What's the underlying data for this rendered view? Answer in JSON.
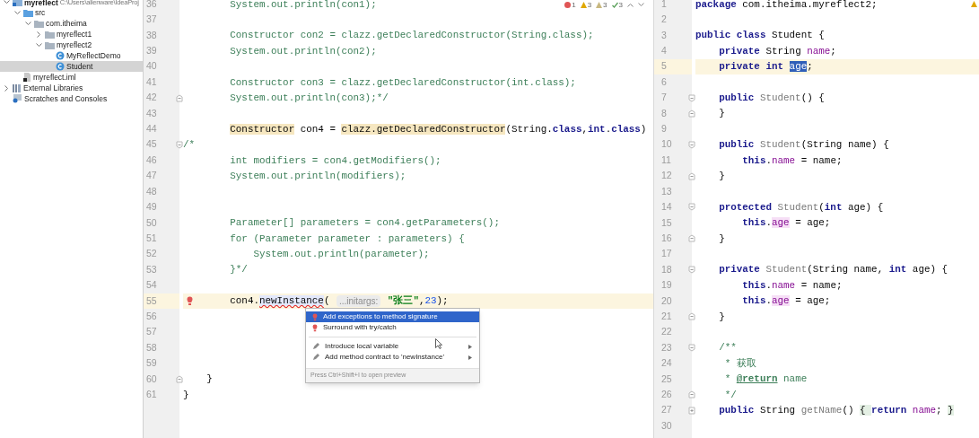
{
  "project_tree": [
    {
      "label": "myreflect",
      "path": "C:\\Users\\alienware\\IdeaProj",
      "kind": "module",
      "expanded": true,
      "selected": false,
      "children": [
        {
          "label": "src",
          "kind": "source-folder",
          "expanded": true,
          "selected": false,
          "children": [
            {
              "label": "com.itheima",
              "kind": "package",
              "expanded": true,
              "selected": false,
              "children": [
                {
                  "label": "myreflect1",
                  "kind": "package",
                  "expanded": false,
                  "selected": false
                },
                {
                  "label": "myreflect2",
                  "kind": "package",
                  "expanded": true,
                  "selected": false,
                  "children": [
                    {
                      "label": "MyReflectDemo",
                      "kind": "class",
                      "selected": false
                    },
                    {
                      "label": "Student",
                      "kind": "class",
                      "selected": true
                    }
                  ]
                }
              ]
            }
          ]
        },
        {
          "label": "myreflect.iml",
          "kind": "file",
          "selected": false
        }
      ]
    },
    {
      "label": "External Libraries",
      "kind": "library",
      "expanded": false,
      "selected": false
    },
    {
      "label": "Scratches and Consoles",
      "kind": "scratches",
      "selected": false
    }
  ],
  "left_editor": {
    "inspections": [
      {
        "kind": "error",
        "count": "1"
      },
      {
        "kind": "warning",
        "count": "3"
      },
      {
        "kind": "weak-warning",
        "count": "3"
      },
      {
        "kind": "typo",
        "count": "3"
      }
    ],
    "lines": [
      {
        "number": "36",
        "tokens": [
          {
            "text": "        System.out.println(con1);",
            "kind": "comment"
          }
        ]
      },
      {
        "number": "37"
      },
      {
        "number": "38",
        "tokens": [
          {
            "text": "        Constructor con2 = clazz.getDeclaredConstructor(String.class);",
            "kind": "comment"
          }
        ]
      },
      {
        "number": "39",
        "tokens": [
          {
            "text": "        System.out.println(con2);",
            "kind": "comment"
          }
        ]
      },
      {
        "number": "40"
      },
      {
        "number": "41",
        "tokens": [
          {
            "text": "        Constructor con3 = clazz.getDeclaredConstructor(int.class);",
            "kind": "comment"
          }
        ]
      },
      {
        "number": "42",
        "fold_end": true,
        "tokens": [
          {
            "text": "        System.out.println(con3);*/",
            "kind": "comment"
          }
        ]
      },
      {
        "number": "43"
      },
      {
        "number": "44",
        "tokens": [
          {
            "text": "        Constructor",
            "kind": "warn"
          },
          {
            "text": " con4 = ",
            "kind": "plain"
          },
          {
            "text": "clazz.getDeclaredConstructor",
            "kind": "warn"
          },
          {
            "text": "(String.",
            "kind": "plain"
          },
          {
            "text": "class",
            "kind": "keyword"
          },
          {
            "text": ",",
            "kind": "plain"
          },
          {
            "text": "int",
            "kind": "keyword"
          },
          {
            "text": ".",
            "kind": "plain"
          },
          {
            "text": "class",
            "kind": "keyword"
          },
          {
            "text": ")",
            "kind": "plain"
          }
        ]
      },
      {
        "number": "45",
        "fold_start": true,
        "tokens": [
          {
            "text": "/*",
            "kind": "comment"
          }
        ]
      },
      {
        "number": "46",
        "tokens": [
          {
            "text": "        int modifiers = con4.getModifiers();",
            "kind": "comment"
          }
        ]
      },
      {
        "number": "47",
        "tokens": [
          {
            "text": "        System.out.println(modifiers);",
            "kind": "comment"
          }
        ]
      },
      {
        "number": "48"
      },
      {
        "number": "49"
      },
      {
        "number": "50",
        "tokens": [
          {
            "text": "        Parameter[] parameters = con4.getParameters();",
            "kind": "comment"
          }
        ]
      },
      {
        "number": "51",
        "tokens": [
          {
            "text": "        for (Parameter parameter : parameters) {",
            "kind": "comment"
          }
        ]
      },
      {
        "number": "52",
        "tokens": [
          {
            "text": "            System.out.println(parameter);",
            "kind": "comment"
          }
        ]
      },
      {
        "number": "53",
        "tokens": [
          {
            "text": "        }*/",
            "kind": "comment"
          }
        ]
      },
      {
        "number": "54"
      },
      {
        "number": "55",
        "current": true,
        "has_error": true,
        "tokens": [
          {
            "text": "        con4.",
            "kind": "plain"
          },
          {
            "text": "newInstance",
            "kind": "error"
          },
          {
            "text": "( ",
            "kind": "plain"
          },
          {
            "text": "...initargs:",
            "kind": "hint"
          },
          {
            "text": " \"张三\"",
            "kind": "string"
          },
          {
            "text": ",",
            "kind": "plain"
          },
          {
            "text": "23",
            "kind": "number"
          },
          {
            "text": ");",
            "kind": "plain"
          }
        ]
      },
      {
        "number": "56"
      },
      {
        "number": "57"
      },
      {
        "number": "58"
      },
      {
        "number": "59"
      },
      {
        "number": "60",
        "fold_end": true,
        "tokens": [
          {
            "text": "    }",
            "kind": "plain"
          }
        ]
      },
      {
        "number": "61",
        "tokens": [
          {
            "text": "}",
            "kind": "plain"
          }
        ]
      }
    ]
  },
  "context_menu": {
    "items": [
      {
        "label": "Add exceptions to method signature",
        "kind": "quick-fix",
        "selected": true,
        "submenu": false
      },
      {
        "label": "Surround with try/catch",
        "kind": "quick-fix",
        "selected": false,
        "submenu": false
      },
      {
        "label": "Introduce local variable",
        "kind": "intention",
        "selected": false,
        "submenu": true,
        "separator_before": true
      },
      {
        "label": "Add method contract to 'newInstance'",
        "kind": "intention",
        "selected": false,
        "submenu": true
      }
    ],
    "footer": "Press Ctrl+Shift+I to open preview"
  },
  "right_editor": {
    "has_warning": true,
    "lines": [
      {
        "number": "1",
        "tokens": [
          {
            "text": "package ",
            "kind": "keyword"
          },
          {
            "text": "com.itheima.myreflect2;",
            "kind": "plain"
          }
        ]
      },
      {
        "number": "2"
      },
      {
        "number": "3",
        "tokens": [
          {
            "text": "public class ",
            "kind": "keyword"
          },
          {
            "text": "Student {",
            "kind": "plain"
          }
        ]
      },
      {
        "number": "4",
        "tokens": [
          {
            "text": "    private ",
            "kind": "keyword"
          },
          {
            "text": "String ",
            "kind": "plain"
          },
          {
            "text": "name",
            "kind": "field"
          },
          {
            "text": ";",
            "kind": "plain"
          }
        ]
      },
      {
        "number": "5",
        "current": true,
        "tokens": [
          {
            "text": "    private int ",
            "kind": "keyword"
          },
          {
            "text": "age",
            "kind": "selected"
          },
          {
            "text": ";",
            "kind": "plain"
          }
        ]
      },
      {
        "number": "6"
      },
      {
        "number": "7",
        "fold_start": true,
        "tokens": [
          {
            "text": "    public ",
            "kind": "keyword"
          },
          {
            "text": "Student",
            "kind": "decl"
          },
          {
            "text": "() {",
            "kind": "plain"
          }
        ]
      },
      {
        "number": "8",
        "fold_end": true,
        "tokens": [
          {
            "text": "    }",
            "kind": "plain"
          }
        ]
      },
      {
        "number": "9"
      },
      {
        "number": "10",
        "fold_start": true,
        "tokens": [
          {
            "text": "    public ",
            "kind": "keyword"
          },
          {
            "text": "Student",
            "kind": "decl"
          },
          {
            "text": "(String name) {",
            "kind": "plain"
          }
        ]
      },
      {
        "number": "11",
        "tokens": [
          {
            "text": "        this",
            "kind": "keyword"
          },
          {
            "text": ".",
            "kind": "plain"
          },
          {
            "text": "name",
            "kind": "field"
          },
          {
            "text": " = name;",
            "kind": "plain"
          }
        ]
      },
      {
        "number": "12",
        "fold_end": true,
        "tokens": [
          {
            "text": "    }",
            "kind": "plain"
          }
        ]
      },
      {
        "number": "13"
      },
      {
        "number": "14",
        "fold_start": true,
        "tokens": [
          {
            "text": "    protected ",
            "kind": "keyword"
          },
          {
            "text": "Student",
            "kind": "decl"
          },
          {
            "text": "(",
            "kind": "plain"
          },
          {
            "text": "int",
            "kind": "keyword"
          },
          {
            "text": " age) {",
            "kind": "plain"
          }
        ]
      },
      {
        "number": "15",
        "tokens": [
          {
            "text": "        this",
            "kind": "keyword"
          },
          {
            "text": ".",
            "kind": "plain"
          },
          {
            "text": "age",
            "kind": "usage"
          },
          {
            "text": " = age;",
            "kind": "plain"
          }
        ]
      },
      {
        "number": "16",
        "fold_end": true,
        "tokens": [
          {
            "text": "    }",
            "kind": "plain"
          }
        ]
      },
      {
        "number": "17"
      },
      {
        "number": "18",
        "fold_start": true,
        "tokens": [
          {
            "text": "    private ",
            "kind": "keyword"
          },
          {
            "text": "Student",
            "kind": "decl"
          },
          {
            "text": "(String name, ",
            "kind": "plain"
          },
          {
            "text": "int",
            "kind": "keyword"
          },
          {
            "text": " age) {",
            "kind": "plain"
          }
        ]
      },
      {
        "number": "19",
        "tokens": [
          {
            "text": "        this",
            "kind": "keyword"
          },
          {
            "text": ".",
            "kind": "plain"
          },
          {
            "text": "name",
            "kind": "field"
          },
          {
            "text": " = name;",
            "kind": "plain"
          }
        ]
      },
      {
        "number": "20",
        "tokens": [
          {
            "text": "        this",
            "kind": "keyword"
          },
          {
            "text": ".",
            "kind": "plain"
          },
          {
            "text": "age",
            "kind": "usage"
          },
          {
            "text": " = age;",
            "kind": "plain"
          }
        ]
      },
      {
        "number": "21",
        "fold_end": true,
        "tokens": [
          {
            "text": "    }",
            "kind": "plain"
          }
        ]
      },
      {
        "number": "22"
      },
      {
        "number": "23",
        "fold_start": true,
        "tokens": [
          {
            "text": "    /**",
            "kind": "comment"
          }
        ]
      },
      {
        "number": "24",
        "tokens": [
          {
            "text": "     * 获取",
            "kind": "comment"
          }
        ]
      },
      {
        "number": "25",
        "tokens": [
          {
            "text": "     * ",
            "kind": "comment"
          },
          {
            "text": "@return",
            "kind": "doctag"
          },
          {
            "text": " name",
            "kind": "comment"
          }
        ]
      },
      {
        "number": "26",
        "fold_end": true,
        "tokens": [
          {
            "text": "     */",
            "kind": "comment"
          }
        ]
      },
      {
        "number": "27",
        "collapsed": true,
        "tokens": [
          {
            "text": "    public ",
            "kind": "keyword"
          },
          {
            "text": "String ",
            "kind": "plain"
          },
          {
            "text": "getName",
            "kind": "decl"
          },
          {
            "text": "() ",
            "kind": "plain"
          },
          {
            "text": "{ ",
            "kind": "folded"
          },
          {
            "text": "return ",
            "kind": "keyword"
          },
          {
            "text": "name",
            "kind": "field"
          },
          {
            "text": ";",
            "kind": "plain"
          },
          {
            "text": " }",
            "kind": "folded"
          }
        ]
      },
      {
        "number": "30"
      }
    ]
  }
}
